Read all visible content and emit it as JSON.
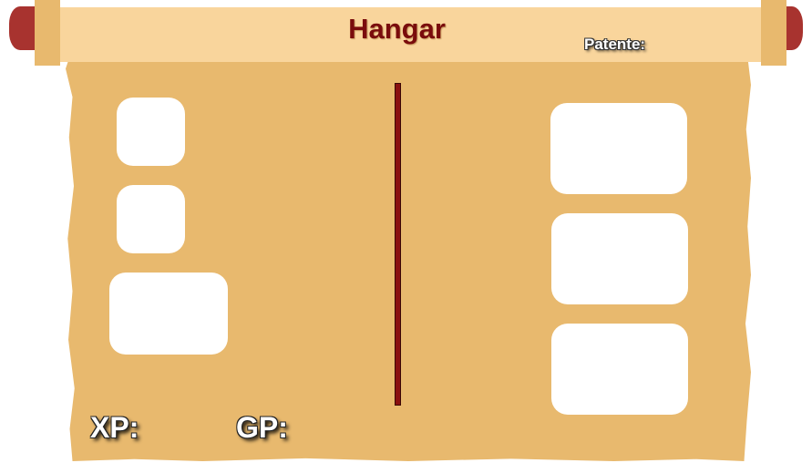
{
  "header": {
    "title": "Hangar",
    "rank_label": "Patente:"
  },
  "stats": {
    "xp_label": "XP:",
    "gp_label": "GP:"
  },
  "colors": {
    "parchment": "#e8b96e",
    "scroll_bar": "#f9d59c",
    "title_text": "#7a0c0c",
    "divider": "#8a1010",
    "knob": "#a8332f"
  }
}
